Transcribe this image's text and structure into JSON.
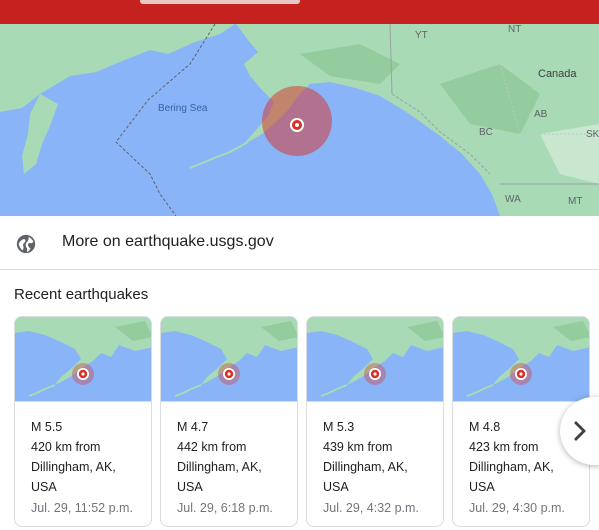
{
  "map": {
    "labels": {
      "canada": "Canada",
      "bering_sea": "Bering Sea",
      "yt": "YT",
      "nt": "NT",
      "bc": "BC",
      "ab": "AB",
      "sk": "SK",
      "wa": "WA",
      "mt": "MT"
    },
    "colors": {
      "water": "#8ab4f8",
      "land": "#a8dab5",
      "quake": "#d93025"
    }
  },
  "source_link": {
    "icon": "globe-icon",
    "text": "More on earthquake.usgs.gov"
  },
  "section_title": "Recent earthquakes",
  "cards": [
    {
      "magnitude": "M 5.5",
      "distance": "420 km from",
      "place": "Dillingham, AK,",
      "country": "USA",
      "date": "Jul. 29, 11:52 p.m."
    },
    {
      "magnitude": "M 4.7",
      "distance": "442 km from",
      "place": "Dillingham, AK,",
      "country": "USA",
      "date": "Jul. 29, 6:18 p.m."
    },
    {
      "magnitude": "M 5.3",
      "distance": "439 km from",
      "place": "Dillingham, AK,",
      "country": "USA",
      "date": "Jul. 29, 4:32 p.m."
    },
    {
      "magnitude": "M 4.8",
      "distance": "423 km from",
      "place": "Dillingham, AK,",
      "country": "USA",
      "date": "Jul. 29, 4:30 p.m."
    }
  ],
  "next_button": {
    "icon": "chevron-right-icon"
  }
}
